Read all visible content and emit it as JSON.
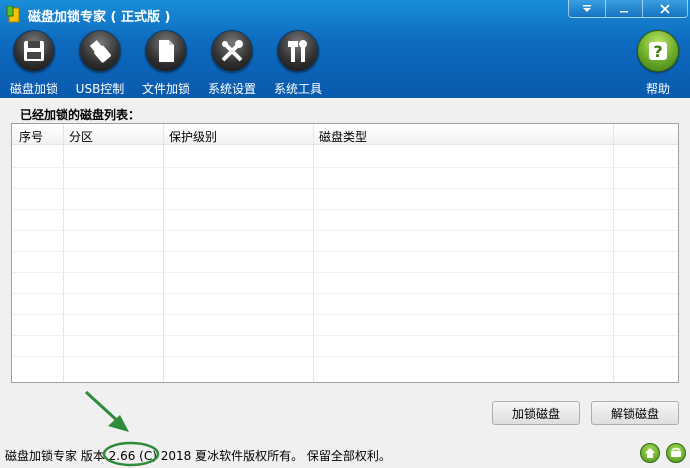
{
  "window": {
    "title": "磁盘加锁专家 ( 正式版 )"
  },
  "toolbar": {
    "items": [
      {
        "label": "磁盘加锁",
        "icon": "disk-lock-icon"
      },
      {
        "label": "USB控制",
        "icon": "usb-icon"
      },
      {
        "label": "文件加锁",
        "icon": "file-icon"
      },
      {
        "label": "系统设置",
        "icon": "tools-icon"
      },
      {
        "label": "系统工具",
        "icon": "wrench-icon"
      }
    ],
    "help": {
      "label": "帮助",
      "icon": "help-icon"
    }
  },
  "main": {
    "list_title": "已经加锁的磁盘列表：",
    "columns": [
      "序号",
      "分区",
      "保护级别",
      "磁盘类型"
    ],
    "rows": []
  },
  "buttons": {
    "lock_disk": "加锁磁盘",
    "unlock_disk": "解锁磁盘"
  },
  "status": {
    "text": "磁盘加锁专家  版本 2.66 (C) 2018 夏冰软件版权所有。 保留全部权利。"
  },
  "colors": {
    "titlebar": "#0e6cc0",
    "annotation": "#2e8b3a",
    "help_accent": "#6aa92a"
  }
}
